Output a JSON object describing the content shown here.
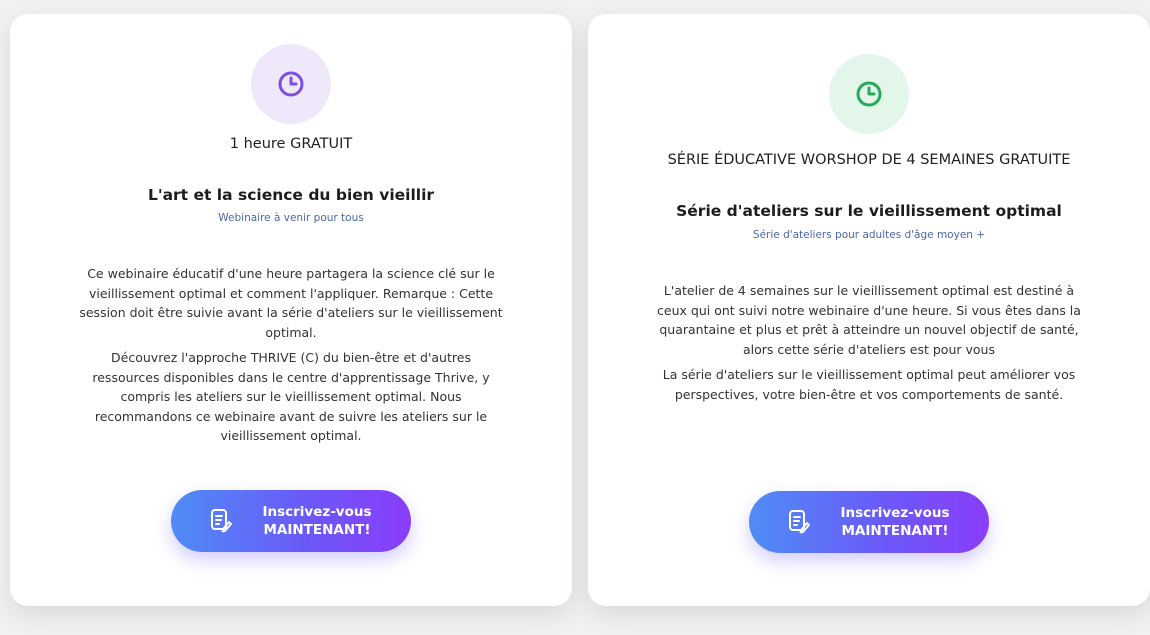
{
  "cards": [
    {
      "kicker": "1 heure GRATUIT",
      "title": "L'art et la science du bien vieillir",
      "subtitle": "Webinaire à venir pour tous",
      "paragraphs": [
        "Ce webinaire éducatif d'une heure partagera la science clé sur le vieillissement optimal et comment l'appliquer. Remarque : Cette session doit être suivie avant la série d'ateliers sur le vieillissement optimal.",
        "Découvrez l'approche THRIVE (C) du bien-être et d'autres ressources disponibles dans le centre d'apprentissage Thrive, y compris les ateliers sur le vieillissement optimal. Nous recommandons ce webinaire avant de suivre les ateliers sur le vieillissement optimal."
      ],
      "cta_line1": "Inscrivez-vous",
      "cta_line2": "MAINTENANT!",
      "icon": "clock-icon",
      "icon_color": "#7b4fe0"
    },
    {
      "kicker": "SÉRIE ÉDUCATIVE WORSHOP DE 4 SEMAINES GRATUITE",
      "title": "Série d'ateliers sur le vieillissement optimal",
      "subtitle": "Série d'ateliers pour adultes d'âge moyen +",
      "paragraphs": [
        "L'atelier de 4 semaines sur le vieillissement optimal est destiné à ceux qui ont suivi notre webinaire d'une heure. Si vous êtes dans la quarantaine et plus et prêt à atteindre un nouvel objectif de santé, alors cette série d'ateliers est pour vous",
        "La série d'ateliers sur le vieillissement optimal peut améliorer vos perspectives, votre bien-être et vos comportements de santé."
      ],
      "cta_line1": "Inscrivez-vous",
      "cta_line2": "MAINTENANT!",
      "icon": "clock-icon",
      "icon_color": "#27a85a"
    }
  ]
}
